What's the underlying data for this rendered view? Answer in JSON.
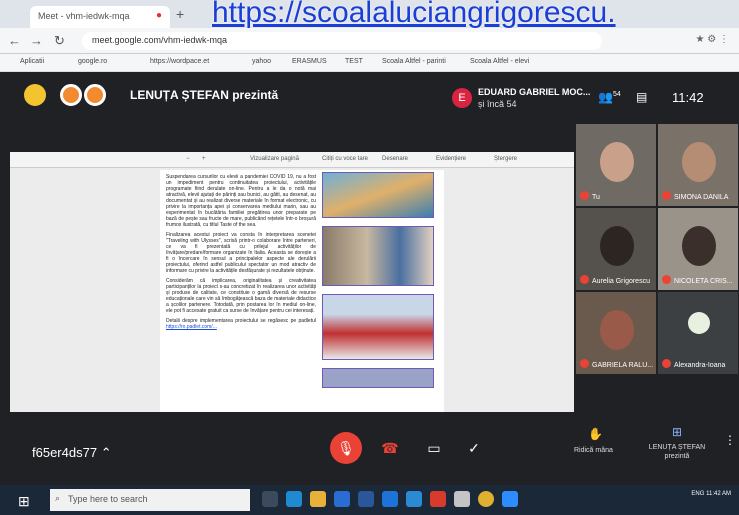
{
  "overlay_url": "https://scoalaluciangrigorescu.",
  "browser": {
    "tab_title": "Meet - vhm-iedwk-mqa",
    "url": "meet.google.com/vhm-iedwk-mqa",
    "bookmarks": [
      "Aplicatii",
      "google.ro",
      "https://wordpace.et",
      "yahoo",
      "ERASMUS",
      "TEST",
      "Scoala Altfel - parinti",
      "Scoala Altfel - elevi"
    ]
  },
  "meet": {
    "presenter_banner": "LENUȚA ȘTEFAN prezintă",
    "host_initial": "E",
    "host_name": "EDUARD GABRIEL MOC...",
    "host_more": "și încă 54",
    "people_count": "54",
    "clock": "11:42",
    "meeting_code": "f65er4ds77",
    "raise_hand_label": "Ridică mâna",
    "presenting_label": "LENUȚA ȘTEFAN prezintă",
    "doc_toolbar": [
      "Vizualizare pagină",
      "Citiți cu voce tare",
      "Desenare",
      "Evidențiere",
      "Ștergere"
    ],
    "doc_paragraphs": [
      "Suspendarea cursurilor cu elevii a pandemiei COVID 19, nu a fost un impediment pentru continuitatea proiectului, activitățile programate fiind derulate on-line. Pentru a le da o notă mai atractivă, elevii ajutați de părinți sau bunici, au gătit, au desenat, au documentat și au realizat diverse materiale în format electronic, cu privire la importanța apei și conservarea mediului marin, sau au experimentat în bucătăria familiei pregătirea unor preparate pe bază de pește sau fructe de mare, publicând rețetele într-o broșură frumos ilustrată, cu titlul Taste of the sea.",
      "Finalizarea acestui proiect va consta în interpretarea scenetei \"Traveling with Ulysses\", scrisă printr-o colaborare între parteneri, ce va fi prezentată cu prilejul activităților de învățare/predare/formare organizate în Italia. Aceasta se dorește a fi o încercare în sensul a principalelor aspecte ale derulării proiectului, oferind astfel publicului spectator un mod atractiv de informare cu privire la activitățile desfășurate și rezultatele obținute.",
      "Considerăm că implicarea, originalitatea și creativitatea participanților la proiect s-au concretizat în realizarea unor activități și produse de calitate, ce constituie o gamă diversă de resurse educaționale care vin să îmbogățească baza de materiale didactice a școlilor partenere. Totodată, prin postarea lor în mediul on-line, ele pot fi accesate gratuit ca surse de învățare pentru cei interesați.",
      "Detalii despre implementarea proiectului se regăsesc pe padletul"
    ],
    "doc_link": "https://ro.padlet.com/...",
    "participants": [
      {
        "name": "Tu"
      },
      {
        "name": "SIMONA DANILA"
      },
      {
        "name": "Aurelia Grigorescu"
      },
      {
        "name": "NICOLETA CRIS..."
      },
      {
        "name": "GABRIELA RALU..."
      },
      {
        "name": "Alexandra-Ioana"
      }
    ]
  },
  "taskbar": {
    "search_placeholder": "Type here to search",
    "tray_time": "11:42 AM",
    "tray_lang": "ENG"
  }
}
